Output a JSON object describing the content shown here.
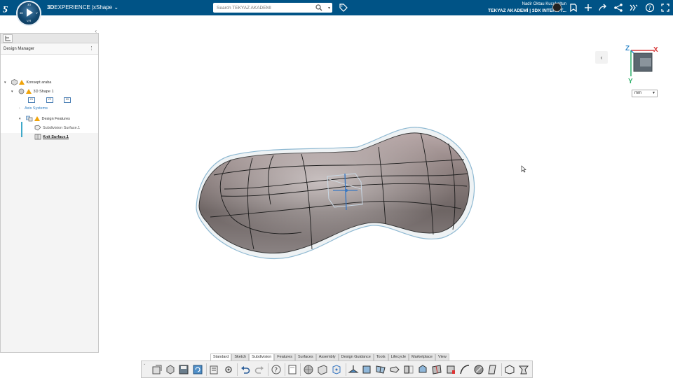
{
  "topbar": {
    "compass": {
      "top": "3D",
      "left": "3D",
      "right": "V",
      "bottom": "V,R"
    },
    "brand_bold": "3D",
    "brand_rest": "EXPERIENCE",
    "separator": "|",
    "app_name": "xShape",
    "search_placeholder": "Search TEKYAZ AKADEMI",
    "user_name": "Nadir Oktau Kucukaltun",
    "tenant": "TEKYAZ AKADEMİ | 3DX INTERN T...",
    "icons": [
      "bookmark-icon",
      "share-icon",
      "add-icon",
      "forward-icon",
      "network-icon",
      "apps-icon",
      "help-icon",
      "fullscreen-icon"
    ],
    "accent_color": "#005386"
  },
  "panel": {
    "title": "Design Manager",
    "tree": [
      {
        "label": "Konsept araba"
      },
      {
        "label": "3D Shape 1"
      },
      {
        "plane_xy": "XY",
        "plane_yz": "YZ",
        "plane_zx": "ZX"
      },
      {
        "label": "Axis Systems"
      },
      {
        "label": "Design Features"
      },
      {
        "label": "Subdivision Surface.1"
      },
      {
        "label": "Knit Surface.1"
      }
    ]
  },
  "viewport": {
    "unit_selected": "mm",
    "compass_axes": {
      "x": "X",
      "y": "Y",
      "z": "Z"
    }
  },
  "bottom": {
    "tabs": [
      "Standard",
      "Sketch",
      "Subdivision",
      "Features",
      "Surfaces",
      "Assembly",
      "Design Guidance",
      "Tools",
      "Lifecycle",
      "Marketplace",
      "View"
    ],
    "active_tab": "Subdivision"
  }
}
